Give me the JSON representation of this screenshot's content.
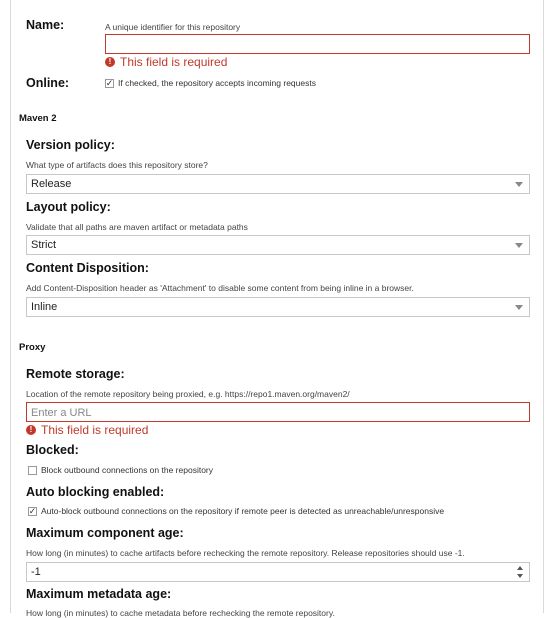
{
  "colors": {
    "error": "#c0392b",
    "border": "#c8c8c8"
  },
  "name": {
    "label": "Name:",
    "help": "A unique identifier for this repository",
    "value": "",
    "error": "This field is required"
  },
  "online": {
    "label": "Online:",
    "checked": true,
    "text": "If checked, the repository accepts incoming requests"
  },
  "maven2": {
    "section_title": "Maven 2",
    "version_policy": {
      "label": "Version policy:",
      "help": "What type of artifacts does this repository store?",
      "value": "Release"
    },
    "layout_policy": {
      "label": "Layout policy:",
      "help": "Validate that all paths are maven artifact or metadata paths",
      "value": "Strict"
    },
    "content_disposition": {
      "label": "Content Disposition:",
      "help": "Add Content-Disposition header as 'Attachment' to disable some content from being inline in a browser.",
      "value": "Inline"
    }
  },
  "proxy": {
    "section_title": "Proxy",
    "remote_storage": {
      "label": "Remote storage:",
      "help": "Location of the remote repository being proxied, e.g. https://repo1.maven.org/maven2/",
      "placeholder": "Enter a URL",
      "error": "This field is required"
    },
    "blocked": {
      "label": "Blocked:",
      "checked": false,
      "text": "Block outbound connections on the repository"
    },
    "auto_blocking": {
      "label": "Auto blocking enabled:",
      "checked": true,
      "text": "Auto-block outbound connections on the repository if remote peer is detected as unreachable/unresponsive"
    },
    "max_component_age": {
      "label": "Maximum component age:",
      "help": "How long (in minutes) to cache artifacts before rechecking the remote repository. Release repositories should use -1.",
      "value": "-1"
    },
    "max_metadata_age": {
      "label": "Maximum metadata age:",
      "help": "How long (in minutes) to cache metadata before rechecking the remote repository."
    }
  }
}
